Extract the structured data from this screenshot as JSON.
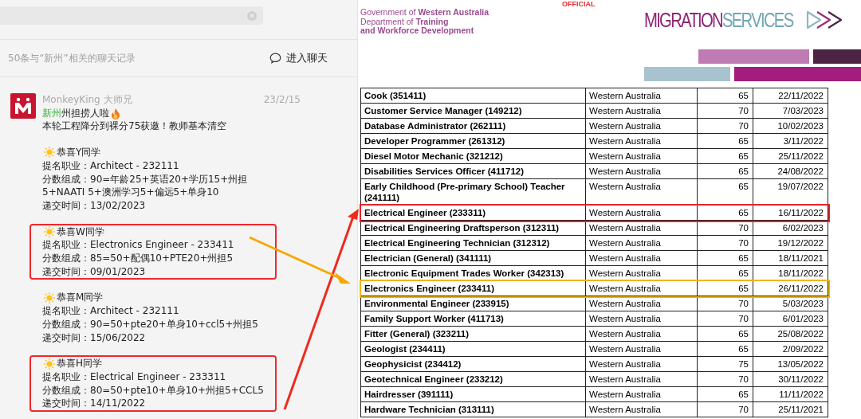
{
  "chat_search": {
    "results_summary": "50条与“新州”相关的聊天记录",
    "enter_chat": "进入聊天",
    "message": {
      "sender": "MonkeyKing 大师兄",
      "date": "23/2/15",
      "keyword": "新州",
      "headline": "州担捞人啦",
      "intro": "本轮工程降分到裸分75获邀！教师基本清空",
      "blocks": [
        {
          "title": "恭喜Y同学",
          "lines": [
            "提名职业：Architect - 232111",
            "分数组成：90=年龄25+英语20+学历15+州担5+NAATI 5+澳洲学习5+偏远5+单身10",
            "递交时间：13/02/2023"
          ],
          "highlighted": false
        },
        {
          "title": "恭喜W同学",
          "lines": [
            "提名职业：Electronics Engineer - 233411",
            "分数组成：85=50+配偶10+PTE20+州担5",
            "递交时间：09/01/2023"
          ],
          "highlighted": true
        },
        {
          "title": "恭喜M同学",
          "lines": [
            "提名职业：Architect - 232111",
            "分数组成：90=50+pte20+单身10+ccl5+州担5",
            "递交时间：15/06/2022"
          ],
          "highlighted": false
        },
        {
          "title": "恭喜H同学",
          "lines": [
            "提名职业：Electrical Engineer - 233311",
            "分数组成：80=50+pte10+单身10+州担5+CCL5",
            "递交时间：14/11/2022"
          ],
          "highlighted": true
        }
      ]
    }
  },
  "document": {
    "marking": "OFFICIAL",
    "department": [
      "Government of **Western Australia**",
      "Department of **Training**",
      "**and Workforce Development**"
    ],
    "logo_primary": "MIGRATION",
    "logo_secondary": "SERVICES",
    "table": {
      "rows": [
        {
          "cells": [
            "Cook (351411)",
            "Western Australia",
            "65",
            "22/11/2022"
          ],
          "highlighted": false
        },
        {
          "cells": [
            "Customer Service Manager (149212)",
            "Western Australia",
            "70",
            "7/03/2023"
          ],
          "highlighted": false
        },
        {
          "cells": [
            "Database Administrator (262111)",
            "Western Australia",
            "70",
            "10/02/2023"
          ],
          "highlighted": false
        },
        {
          "cells": [
            "Developer Programmer (261312)",
            "Western Australia",
            "65",
            "3/11/2022"
          ],
          "highlighted": false
        },
        {
          "cells": [
            "Diesel Motor Mechanic (321212)",
            "Western Australia",
            "65",
            "25/11/2022"
          ],
          "highlighted": false
        },
        {
          "cells": [
            "Disabilities Services Officer (411712)",
            "Western Australia",
            "65",
            "24/08/2022"
          ],
          "highlighted": false
        },
        {
          "cells": [
            "Early Childhood (Pre-primary School) Teacher (241111)",
            "Western Australia",
            "65",
            "19/07/2022"
          ],
          "highlighted": false
        },
        {
          "cells": [
            "Electrical Engineer (233311)",
            "Western Australia",
            "65",
            "16/11/2022"
          ],
          "highlighted": true,
          "color": "#e8222a"
        },
        {
          "cells": [
            "Electrical Engineering Draftsperson (312311)",
            "Western Australia",
            "70",
            "6/02/2023"
          ],
          "highlighted": false
        },
        {
          "cells": [
            "Electrical Engineering Technician (312312)",
            "Western Australia",
            "70",
            "19/12/2022"
          ],
          "highlighted": false
        },
        {
          "cells": [
            "Electrician (General) (341111)",
            "Western Australia",
            "65",
            "18/11/2021"
          ],
          "highlighted": false
        },
        {
          "cells": [
            "Electronic Equipment Trades Worker (342313)",
            "Western Australia",
            "65",
            "18/11/2022"
          ],
          "highlighted": false
        },
        {
          "cells": [
            "Electronics Engineer (233411)",
            "Western Australia",
            "65",
            "26/11/2022"
          ],
          "highlighted": true,
          "color": "#f5b400"
        },
        {
          "cells": [
            "Environmental Engineer (233915)",
            "Western Australia",
            "70",
            "5/03/2023"
          ],
          "highlighted": false
        },
        {
          "cells": [
            "Family Support Worker (411713)",
            "Western Australia",
            "70",
            "6/01/2023"
          ],
          "highlighted": false
        },
        {
          "cells": [
            "Fitter (General) (323211)",
            "Western Australia",
            "65",
            "25/08/2022"
          ],
          "highlighted": false
        },
        {
          "cells": [
            "Geologist (234411)",
            "Western Australia",
            "65",
            "2/09/2022"
          ],
          "highlighted": false
        },
        {
          "cells": [
            "Geophysicist (234412)",
            "Western Australia",
            "75",
            "13/05/2022"
          ],
          "highlighted": false
        },
        {
          "cells": [
            "Geotechnical Engineer (233212)",
            "Western Australia",
            "70",
            "30/11/2022"
          ],
          "highlighted": false
        },
        {
          "cells": [
            "Hairdresser (391111)",
            "Western Australia",
            "65",
            "11/11/2022"
          ],
          "highlighted": false
        },
        {
          "cells": [
            "Hardware Technician (313111)",
            "Western Australia",
            "70",
            "25/11/2021"
          ],
          "highlighted": false
        }
      ]
    }
  },
  "annotations": [
    {
      "kind": "arrow",
      "color": "#ee2a1e"
    },
    {
      "kind": "arrow",
      "color": "#f5a800"
    }
  ]
}
